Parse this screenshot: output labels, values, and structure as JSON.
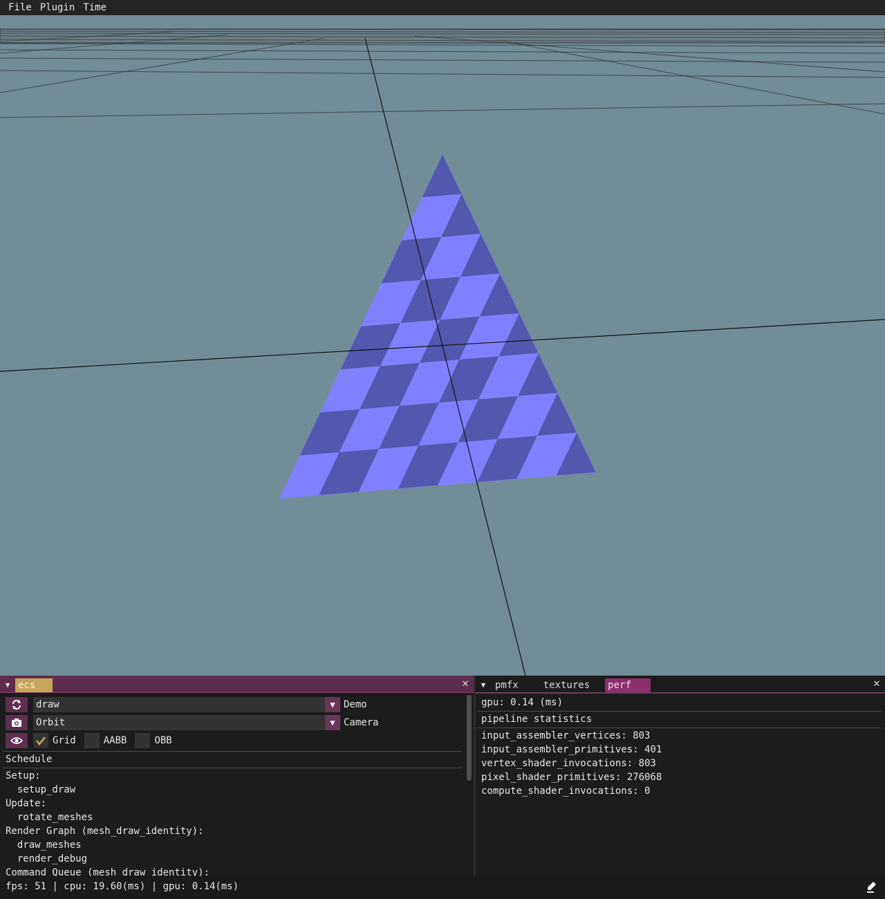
{
  "menu": {
    "items": [
      "File",
      "Plugin",
      "Time"
    ]
  },
  "ecs_panel": {
    "tab": "ecs",
    "demo_select": {
      "value": "draw",
      "label": "Demo"
    },
    "camera_select": {
      "value": "Orbit",
      "label": "Camera"
    },
    "view_toggles": [
      {
        "label": "Grid",
        "checked": true
      },
      {
        "label": "AABB",
        "checked": false
      },
      {
        "label": "OBB",
        "checked": false
      }
    ],
    "schedule_header": "Schedule",
    "schedule_lines": [
      "Setup:",
      "  setup_draw",
      "Update:",
      "  rotate_meshes",
      "Render Graph (mesh_draw_identity):",
      "  draw_meshes",
      "  render_debug",
      "Command Queue (mesh draw identity):"
    ]
  },
  "perf_panel": {
    "tabs": [
      "pmfx",
      "textures",
      "perf"
    ],
    "active_tab": "perf",
    "gpu_line": "gpu: 0.14 (ms)",
    "pipeline_header": "pipeline statistics",
    "stats": [
      "input_assembler_vertices: 803",
      "input_assembler_primitives: 401",
      "vertex_shader_invocations: 803",
      "pixel_shader_primitives: 276068",
      "compute_shader_invocations: 0"
    ]
  },
  "status_bar": {
    "text": "fps: 51 | cpu: 19.60(ms) | gpu: 0.14(ms)"
  },
  "colors": {
    "viewport_bg": "#728c98",
    "checker_light": "#8080fe",
    "checker_dark": "#5357ae",
    "accent_pink": "#8c2f6b",
    "accent_gold": "#c8a55c"
  },
  "icons": {
    "reload": "reload-icon",
    "camera": "camera-icon",
    "eye": "eye-icon",
    "check": "checkmark-icon",
    "close": "close-icon",
    "status": "pen-icon"
  }
}
